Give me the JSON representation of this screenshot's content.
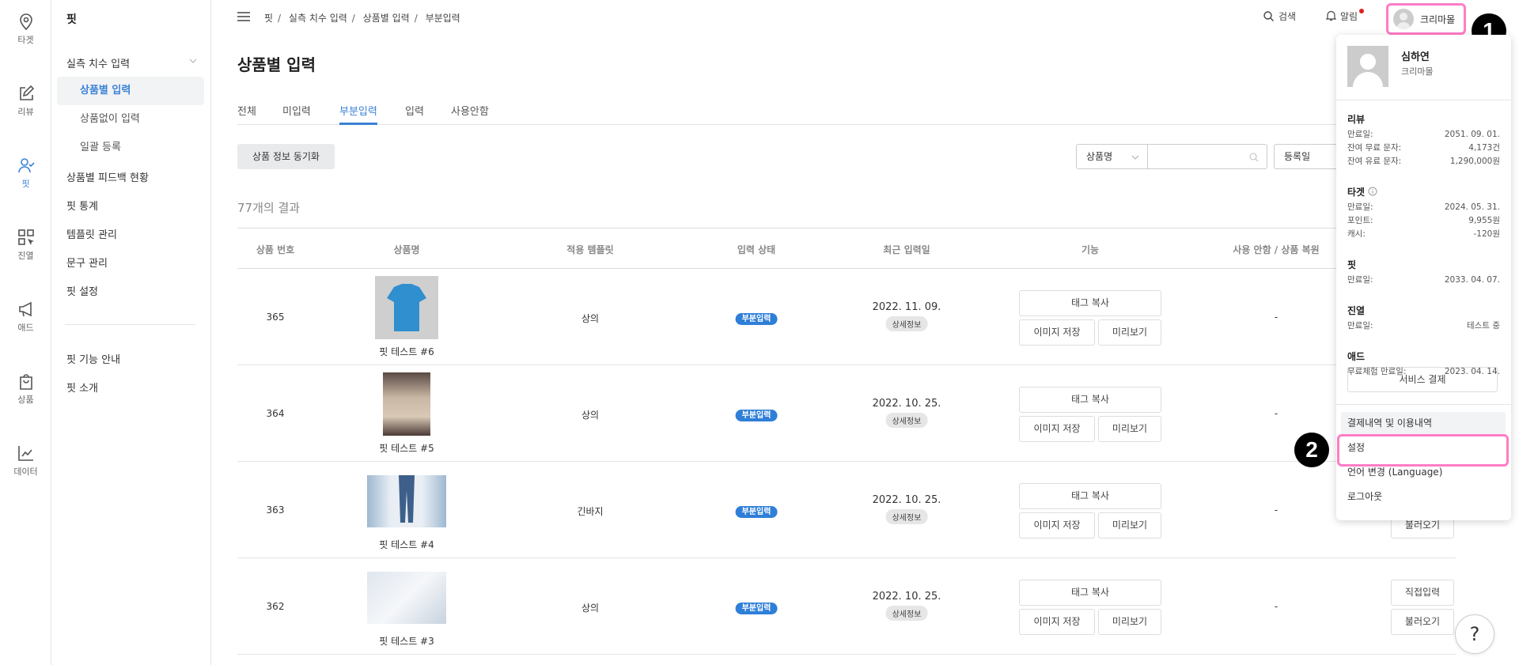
{
  "rail": [
    {
      "label": "타겟",
      "icon": "map-pin-icon"
    },
    {
      "label": "리뷰",
      "icon": "edit-icon"
    },
    {
      "label": "핏",
      "icon": "user-check-icon",
      "active": true
    },
    {
      "label": "진열",
      "icon": "grid-cursor-icon"
    },
    {
      "label": "애드",
      "icon": "megaphone-icon"
    },
    {
      "label": "상품",
      "icon": "shopping-bag-icon"
    },
    {
      "label": "데이터",
      "icon": "chart-line-icon"
    }
  ],
  "sidebar": {
    "title": "핏",
    "group": "실측 치수 입력",
    "subs": [
      "상품별 입력",
      "상품없이 입력",
      "일괄 등록"
    ],
    "items": [
      "상품별 피드백 현황",
      "핏 통계",
      "템플릿 관리",
      "문구 관리",
      "핏 설정"
    ],
    "footer": [
      "핏 기능 안내",
      "핏 소개"
    ]
  },
  "breadcrumb": [
    "핏",
    "실측 치수 입력",
    "상품별 입력",
    "부분입력"
  ],
  "header": {
    "search": "검색",
    "alerts": "알림",
    "profile": "크리마몰"
  },
  "page": {
    "title": "상품별 입력",
    "tabs": [
      "전체",
      "미입력",
      "부분입력",
      "입력",
      "사용안함"
    ],
    "active_tab": 2,
    "sync_button": "상품 정보 동기화",
    "search_select": "상품명",
    "search_value": "",
    "date_select": "등록일",
    "result_count": "77개의 결과"
  },
  "table": {
    "headers": [
      "상품 번호",
      "상품명",
      "적용 템플릿",
      "입력 상태",
      "최근 입력일",
      "기능",
      "사용 안함 / 상품 복원"
    ],
    "rows": [
      {
        "id": "365",
        "name": "핏 테스트 #6",
        "template": "상의",
        "status": "부분입력",
        "date": "2022. 11. 09.",
        "detail": "상세정보",
        "disable": "-",
        "actions": []
      },
      {
        "id": "364",
        "name": "핏 테스트 #5",
        "template": "상의",
        "status": "부분입력",
        "date": "2022. 10. 25.",
        "detail": "상세정보",
        "disable": "-",
        "actions": []
      },
      {
        "id": "363",
        "name": "핏 테스트 #4",
        "template": "긴바지",
        "status": "부분입력",
        "date": "2022. 10. 25.",
        "detail": "상세정보",
        "disable": "-",
        "actions": [
          "불러오기"
        ]
      },
      {
        "id": "362",
        "name": "핏 테스트 #3",
        "template": "상의",
        "status": "부분입력",
        "date": "2022. 10. 25.",
        "detail": "상세정보",
        "disable": "-",
        "actions": [
          "직접입력",
          "불러오기"
        ]
      }
    ],
    "buttons": {
      "tag_copy": "태그 복사",
      "save_image": "이미지 저장",
      "preview": "미리보기"
    }
  },
  "dropdown": {
    "name": "심하연",
    "shop": "크리마몰",
    "sections": [
      {
        "title": "리뷰",
        "lines": [
          [
            "만료일:",
            "2051. 09. 01."
          ],
          [
            "잔여 무료 문자:",
            "4,173건"
          ],
          [
            "잔여 유료 문자:",
            "1,290,000원"
          ]
        ]
      },
      {
        "title": "타겟",
        "info": true,
        "lines": [
          [
            "만료일:",
            "2024. 05. 31."
          ],
          [
            "포인트:",
            "9,955원"
          ],
          [
            "캐시:",
            "-120원"
          ]
        ]
      },
      {
        "title": "핏",
        "lines": [
          [
            "만료일:",
            "2033. 04. 07."
          ]
        ]
      },
      {
        "title": "진열",
        "lines": [
          [
            "만료일:",
            "테스트 중"
          ]
        ]
      },
      {
        "title": "애드",
        "lines": [
          [
            "무료체험 만료일:",
            "2023. 04. 14."
          ]
        ]
      }
    ],
    "pay_button": "서비스 결제",
    "menu": [
      "결제내역 및 이용내역",
      "설정",
      "언어 변경 (Language)",
      "로그아웃"
    ]
  },
  "annotations": [
    "1",
    "2"
  ],
  "help": "?",
  "colors": {
    "accent": "#3b82d6",
    "badge": "#2f7fd9",
    "highlight": "#ff7cc6",
    "alert_dot": "#e02020"
  }
}
